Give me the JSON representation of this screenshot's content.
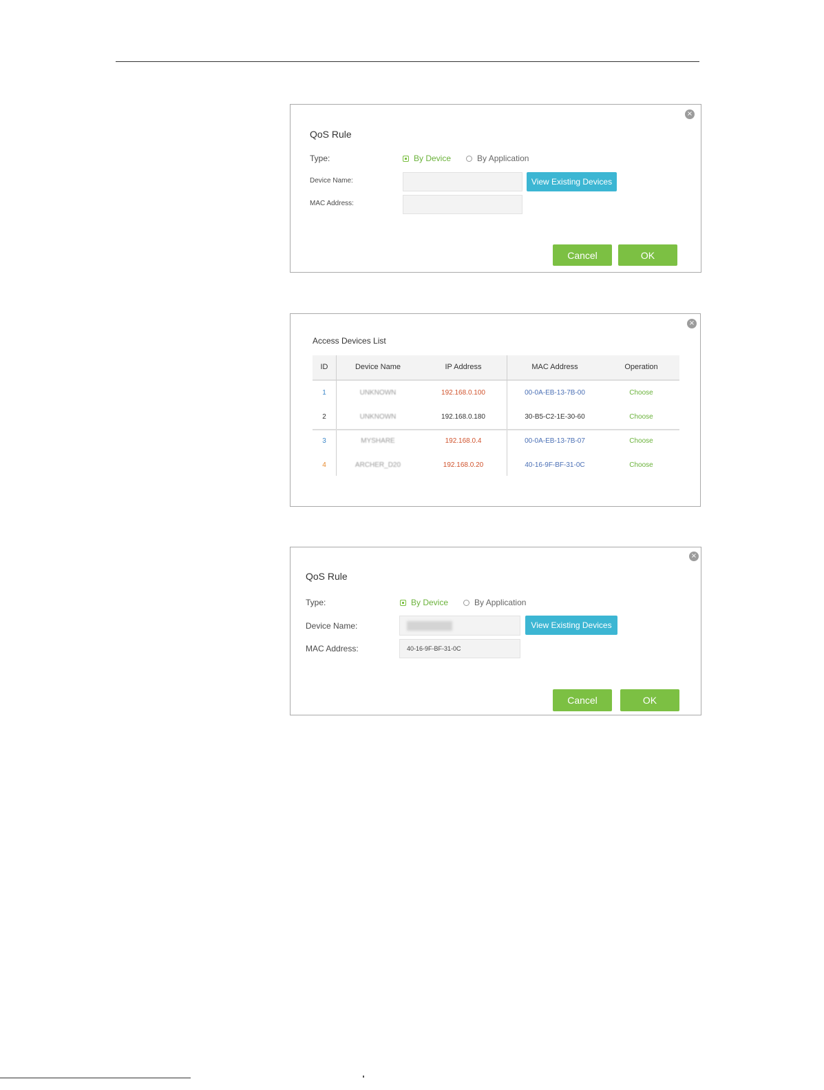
{
  "panel1": {
    "title": "QoS Rule",
    "type_label": "Type:",
    "type_options": [
      {
        "label": "By Device",
        "selected": true
      },
      {
        "label": "By Application",
        "selected": false
      }
    ],
    "device_name_label": "Device Name:",
    "device_name_value": "",
    "mac_label": "MAC Address:",
    "mac_value": "",
    "view_button": "View Existing Devices",
    "cancel": "Cancel",
    "ok": "OK",
    "close_glyph": "×"
  },
  "panel2": {
    "title": "Access Devices List",
    "close_glyph": "×",
    "columns": [
      "ID",
      "Device Name",
      "IP Address",
      "MAC Address",
      "Operation"
    ],
    "rows": [
      {
        "id": "1",
        "name": "UNKNOWN",
        "ip": "192.168.0.100",
        "mac": "00-0A-EB-13-7B-00",
        "op": "Choose"
      },
      {
        "id": "2",
        "name": "UNKNOWN",
        "ip": "192.168.0.180",
        "mac": "30-B5-C2-1E-30-60",
        "op": "Choose"
      },
      {
        "id": "3",
        "name": "MYSHARE",
        "ip": "192.168.0.4",
        "mac": "00-0A-EB-13-7B-07",
        "op": "Choose"
      },
      {
        "id": "4",
        "name": "ARCHER_D20",
        "ip": "192.168.0.20",
        "mac": "40-16-9F-BF-31-0C",
        "op": "Choose"
      }
    ]
  },
  "panel3": {
    "title": "QoS Rule",
    "type_label": "Type:",
    "type_options": [
      {
        "label": "By Device",
        "selected": true
      },
      {
        "label": "By Application",
        "selected": false
      }
    ],
    "device_name_label": "Device Name:",
    "mac_label": "MAC Address:",
    "mac_value": "40-16-9F-BF-31-0C",
    "view_button": "View Existing Devices",
    "cancel": "Cancel",
    "ok": "OK",
    "close_glyph": "×"
  },
  "colors": {
    "accent_green": "#7cc043",
    "accent_blue": "#3cb6d3",
    "border": "#a9a9a9"
  }
}
